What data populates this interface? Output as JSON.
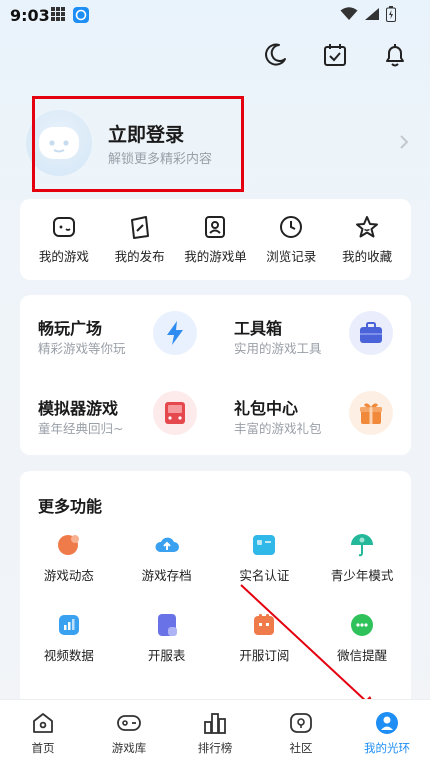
{
  "status_bar": {
    "time": "9:03"
  },
  "header": {
    "actions": [
      "moon-icon",
      "calendar-check-icon",
      "bell-icon"
    ]
  },
  "profile": {
    "title": "立即登录",
    "subtitle": "解锁更多精彩内容"
  },
  "quick_links": [
    {
      "label": "我的游戏",
      "icon": "gamepad-icon"
    },
    {
      "label": "我的发布",
      "icon": "publish-icon"
    },
    {
      "label": "我的游戏单",
      "icon": "game-list-icon"
    },
    {
      "label": "浏览记录",
      "icon": "clock-icon"
    },
    {
      "label": "我的收藏",
      "icon": "star-icon"
    }
  ],
  "features": [
    {
      "title": "畅玩广场",
      "subtitle": "精彩游戏等你玩",
      "icon": "lightning-icon",
      "color": "#2f8cf0"
    },
    {
      "title": "工具箱",
      "subtitle": "实用的游戏工具",
      "icon": "toolbox-icon",
      "color": "#4a63d8"
    },
    {
      "title": "模拟器游戏",
      "subtitle": "童年经典回归~",
      "icon": "emulator-icon",
      "color": "#e5484d"
    },
    {
      "title": "礼包中心",
      "subtitle": "丰富的游戏礼包",
      "icon": "gift-icon",
      "color": "#f08a3a"
    }
  ],
  "more": {
    "title": "更多功能",
    "items": [
      {
        "label": "游戏动态",
        "icon": "activity-icon",
        "color": "#f07b4a"
      },
      {
        "label": "游戏存档",
        "icon": "cloud-save-icon",
        "color": "#3aa0f0"
      },
      {
        "label": "实名认证",
        "icon": "id-card-icon",
        "color": "#2fb8e8"
      },
      {
        "label": "青少年模式",
        "icon": "umbrella-icon",
        "color": "#23b89a"
      },
      {
        "label": "视频数据",
        "icon": "chart-icon",
        "color": "#3aa0f0"
      },
      {
        "label": "开服表",
        "icon": "server-list-icon",
        "color": "#6a72e8"
      },
      {
        "label": "开服订阅",
        "icon": "subscribe-icon",
        "color": "#f07b4a"
      },
      {
        "label": "微信提醒",
        "icon": "wechat-icon",
        "color": "#2fc25b"
      }
    ]
  },
  "bottom_nav": [
    {
      "label": "首页",
      "icon": "home-icon",
      "active": false
    },
    {
      "label": "游戏库",
      "icon": "controller-icon",
      "active": false
    },
    {
      "label": "排行榜",
      "icon": "ranking-icon",
      "active": false
    },
    {
      "label": "社区",
      "icon": "community-icon",
      "active": false
    },
    {
      "label": "我的光环",
      "icon": "profile-icon",
      "active": true
    }
  ],
  "colors": {
    "accent": "#1e8ef5",
    "highlight": "#e4000f",
    "arrow": "#e4000f"
  }
}
